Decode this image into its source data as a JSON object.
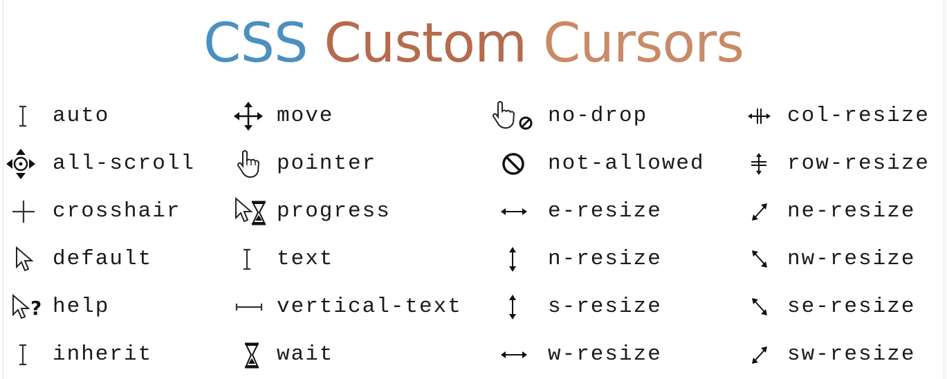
{
  "title": {
    "part1": "CSS",
    "part2": "Custom",
    "part3": "Cursors"
  },
  "colors": {
    "title_css": "#4a90c0",
    "title_custom": "#b56b4c",
    "title_cursors": "#c98a68",
    "text": "#1a1a1a"
  },
  "cursors": [
    {
      "label": "auto",
      "icon": "i-beam-icon"
    },
    {
      "label": "all-scroll",
      "icon": "all-scroll-icon"
    },
    {
      "label": "crosshair",
      "icon": "crosshair-icon"
    },
    {
      "label": "default",
      "icon": "arrow-pointer-icon"
    },
    {
      "label": "help",
      "icon": "help-arrow-icon"
    },
    {
      "label": "inherit",
      "icon": "i-beam-icon"
    },
    {
      "label": "move",
      "icon": "move-arrows-icon"
    },
    {
      "label": "pointer",
      "icon": "hand-pointer-icon"
    },
    {
      "label": "progress",
      "icon": "arrow-hourglass-icon"
    },
    {
      "label": "text",
      "icon": "i-beam-icon"
    },
    {
      "label": "vertical-text",
      "icon": "vertical-text-icon"
    },
    {
      "label": "wait",
      "icon": "hourglass-icon"
    },
    {
      "label": "no-drop",
      "icon": "hand-no-drop-icon"
    },
    {
      "label": "not-allowed",
      "icon": "not-allowed-icon"
    },
    {
      "label": "e-resize",
      "icon": "horizontal-arrow-icon"
    },
    {
      "label": "n-resize",
      "icon": "vertical-arrow-icon"
    },
    {
      "label": "s-resize",
      "icon": "vertical-arrow-icon"
    },
    {
      "label": "w-resize",
      "icon": "horizontal-arrow-icon"
    },
    {
      "label": "col-resize",
      "icon": "col-resize-icon"
    },
    {
      "label": "row-resize",
      "icon": "row-resize-icon"
    },
    {
      "label": "ne-resize",
      "icon": "diagonal-ne-arrow-icon"
    },
    {
      "label": "nw-resize",
      "icon": "diagonal-nw-arrow-icon"
    },
    {
      "label": "se-resize",
      "icon": "diagonal-nw-arrow-icon"
    },
    {
      "label": "sw-resize",
      "icon": "diagonal-ne-arrow-icon"
    }
  ]
}
